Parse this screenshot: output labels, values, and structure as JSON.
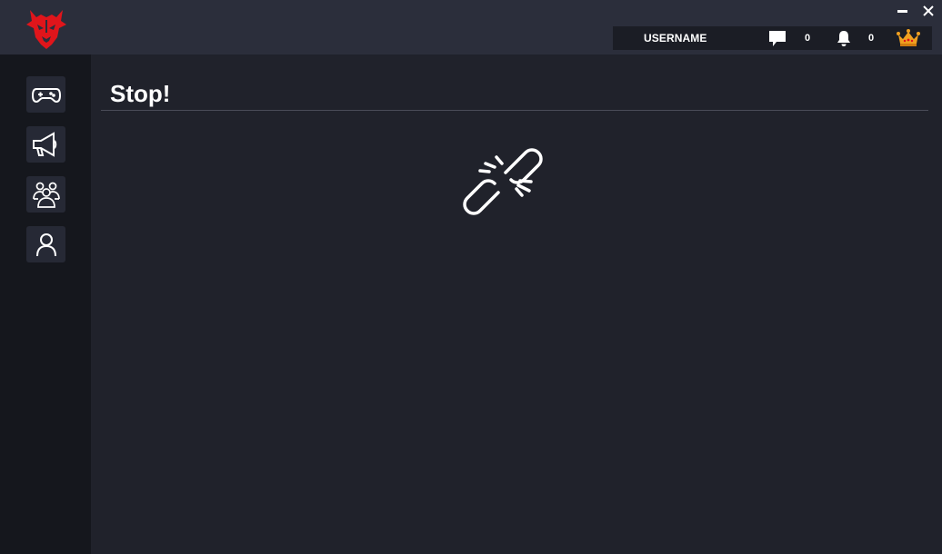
{
  "header": {
    "logo_icon": "red-demon-logo",
    "window_controls": {
      "minimize_icon": "minimize-icon",
      "close_icon": "close-icon"
    }
  },
  "userbar": {
    "username": "USERNAME",
    "messages_icon": "chat-bubble-icon",
    "messages_count": "0",
    "notifications_icon": "bell-icon",
    "notifications_count": "0",
    "premium_icon": "crown-icon"
  },
  "sidebar": {
    "items": [
      {
        "icon": "gamepad-icon"
      },
      {
        "icon": "megaphone-icon"
      },
      {
        "icon": "group-icon"
      },
      {
        "icon": "user-icon"
      }
    ]
  },
  "main": {
    "title": "Stop!",
    "illustration": "broken-link-icon"
  },
  "colors": {
    "topbar": "#2b2e3b",
    "sidebar": "#15171d",
    "content": "#20222b",
    "accent_red": "#e0151b",
    "crown_gold": "#f0a020"
  }
}
